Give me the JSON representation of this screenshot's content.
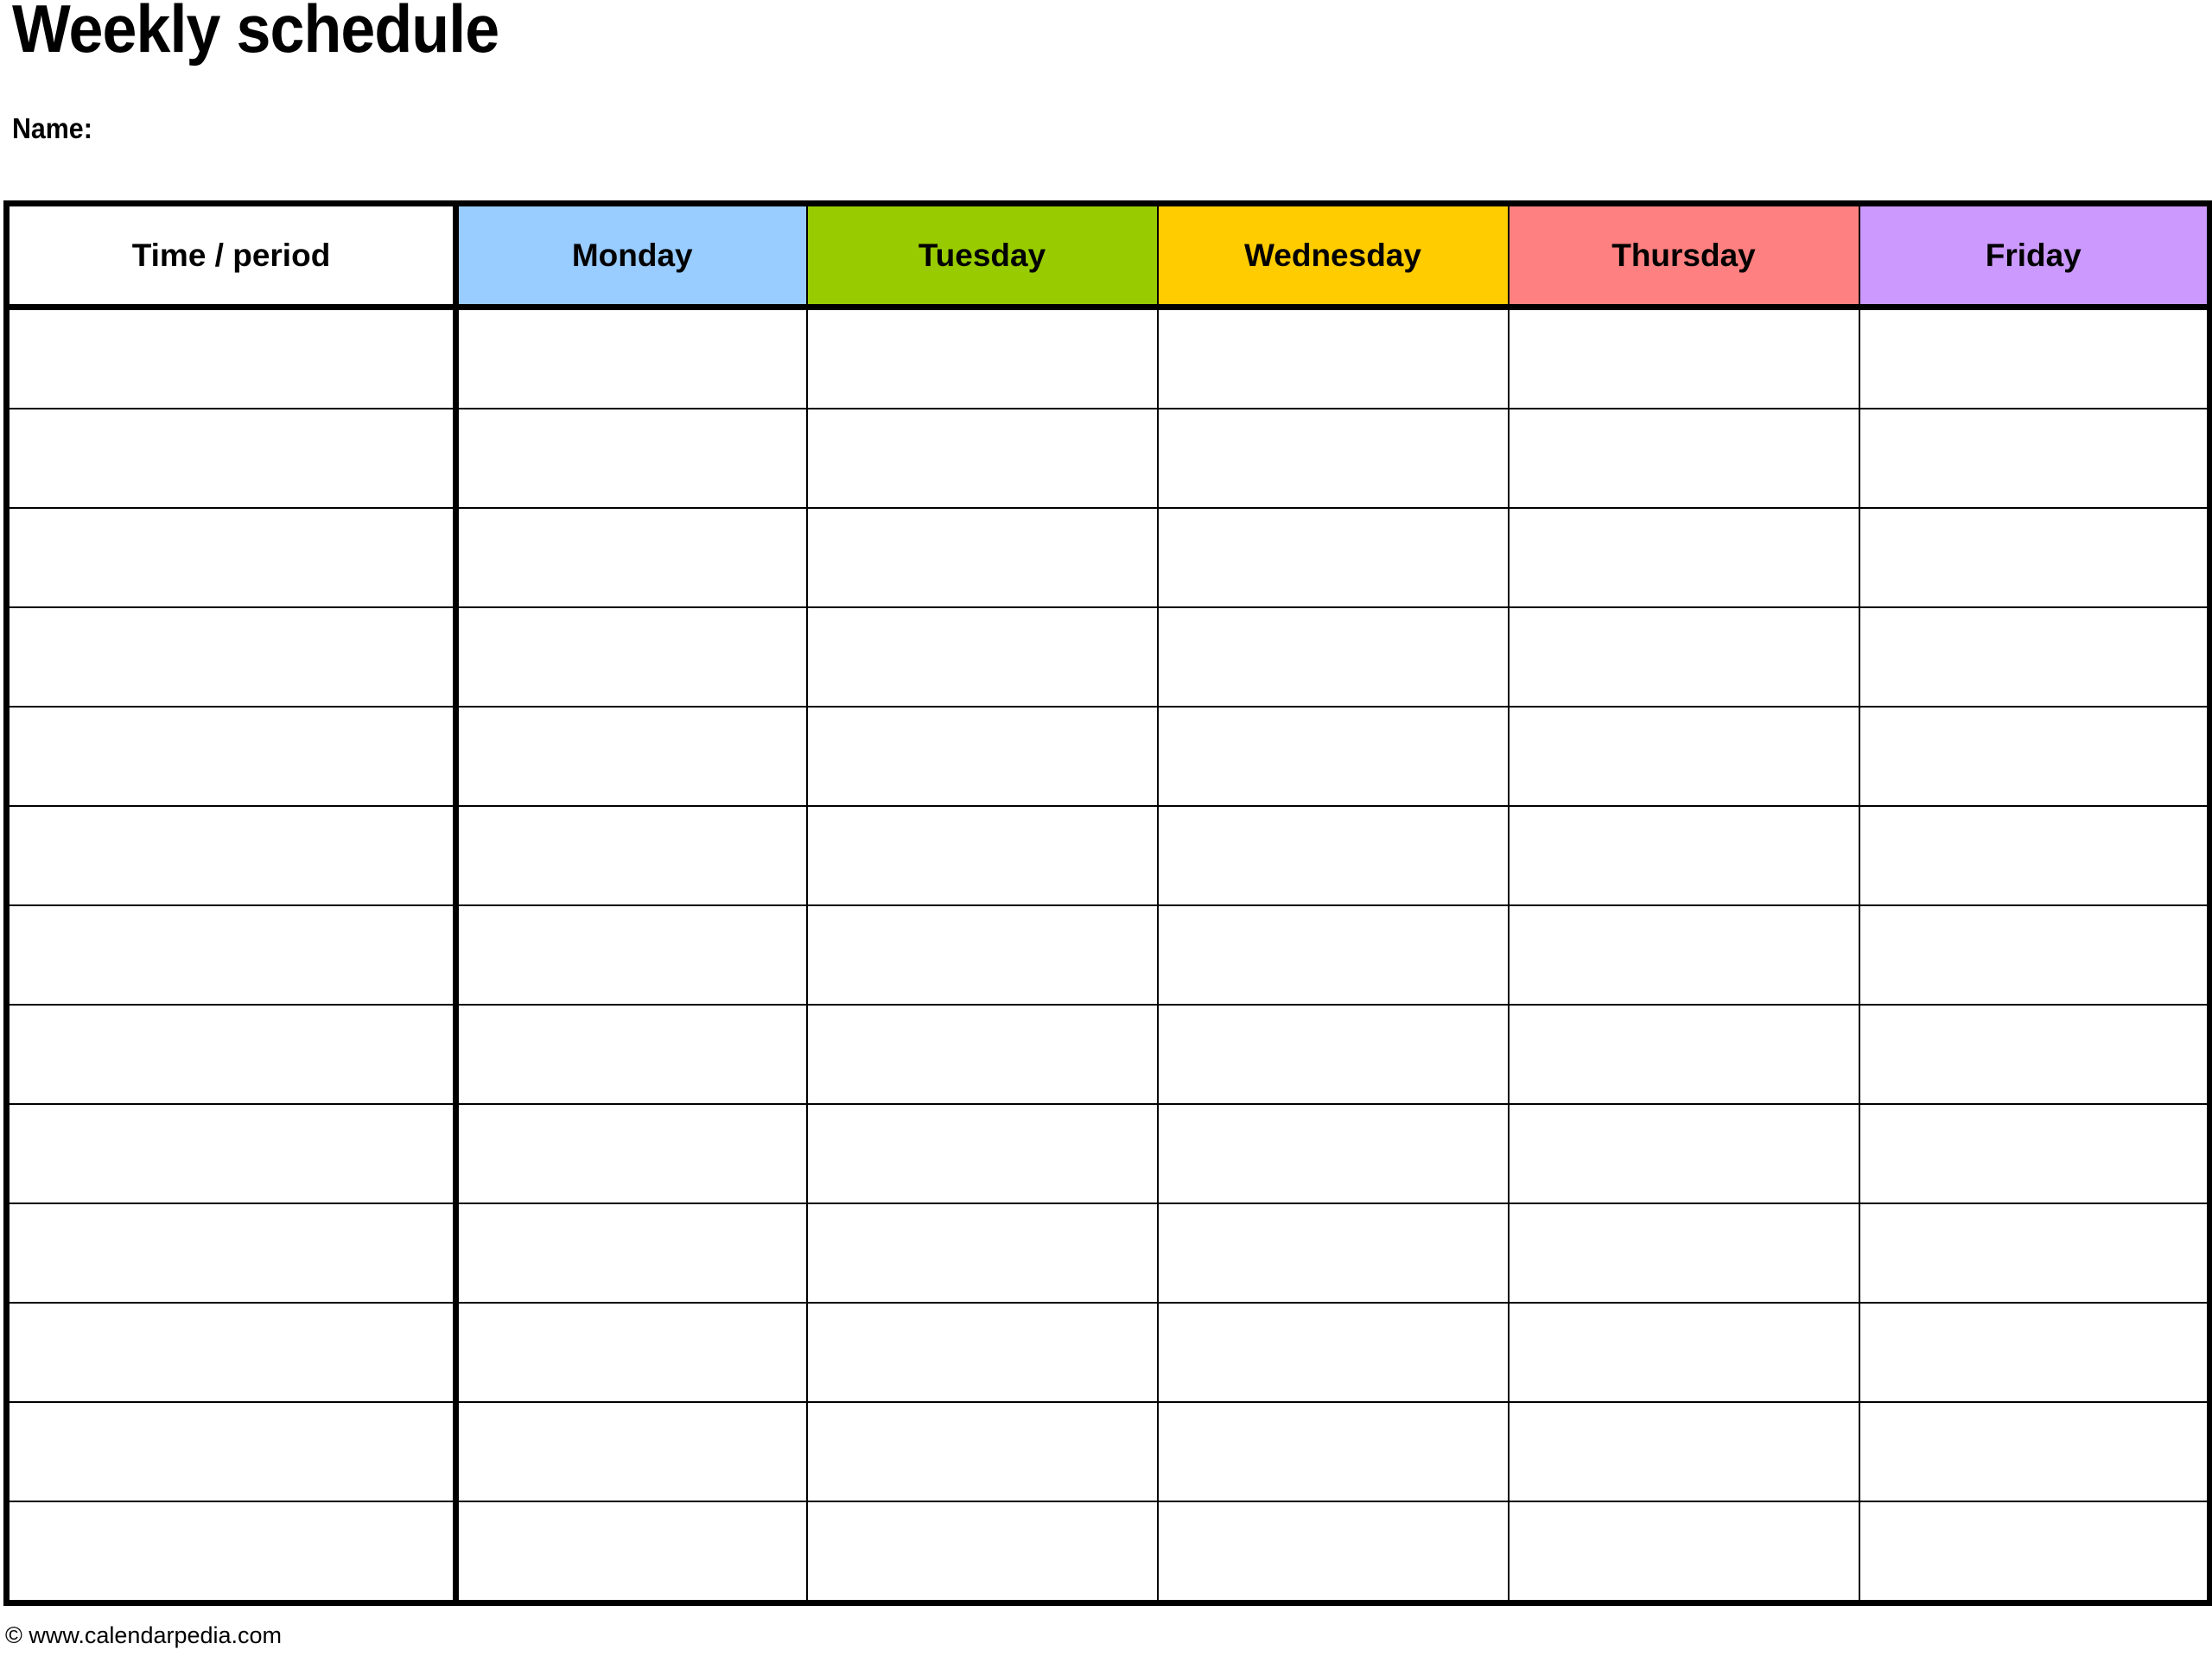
{
  "document": {
    "title": "Weekly schedule",
    "name_label": "Name:",
    "footer": "© www.calendarpedia.com"
  },
  "table": {
    "headers": [
      {
        "label": "Time / period",
        "bg": "#ffffff"
      },
      {
        "label": "Monday",
        "bg": "#99ccff"
      },
      {
        "label": "Tuesday",
        "bg": "#99cc00"
      },
      {
        "label": "Wednesday",
        "bg": "#ffcc00"
      },
      {
        "label": "Thursday",
        "bg": "#ff8080"
      },
      {
        "label": "Friday",
        "bg": "#cc99ff"
      }
    ],
    "row_count": 13,
    "rows": [
      {
        "time": "",
        "cells": [
          "",
          "",
          "",
          "",
          ""
        ]
      },
      {
        "time": "",
        "cells": [
          "",
          "",
          "",
          "",
          ""
        ]
      },
      {
        "time": "",
        "cells": [
          "",
          "",
          "",
          "",
          ""
        ]
      },
      {
        "time": "",
        "cells": [
          "",
          "",
          "",
          "",
          ""
        ]
      },
      {
        "time": "",
        "cells": [
          "",
          "",
          "",
          "",
          ""
        ]
      },
      {
        "time": "",
        "cells": [
          "",
          "",
          "",
          "",
          ""
        ]
      },
      {
        "time": "",
        "cells": [
          "",
          "",
          "",
          "",
          ""
        ]
      },
      {
        "time": "",
        "cells": [
          "",
          "",
          "",
          "",
          ""
        ]
      },
      {
        "time": "",
        "cells": [
          "",
          "",
          "",
          "",
          ""
        ]
      },
      {
        "time": "",
        "cells": [
          "",
          "",
          "",
          "",
          ""
        ]
      },
      {
        "time": "",
        "cells": [
          "",
          "",
          "",
          "",
          ""
        ]
      },
      {
        "time": "",
        "cells": [
          "",
          "",
          "",
          "",
          ""
        ]
      },
      {
        "time": "",
        "cells": [
          "",
          "",
          "",
          "",
          ""
        ]
      }
    ]
  },
  "colors": {
    "border": "#000000",
    "page_background": "#ffffff",
    "text": "#000000"
  }
}
